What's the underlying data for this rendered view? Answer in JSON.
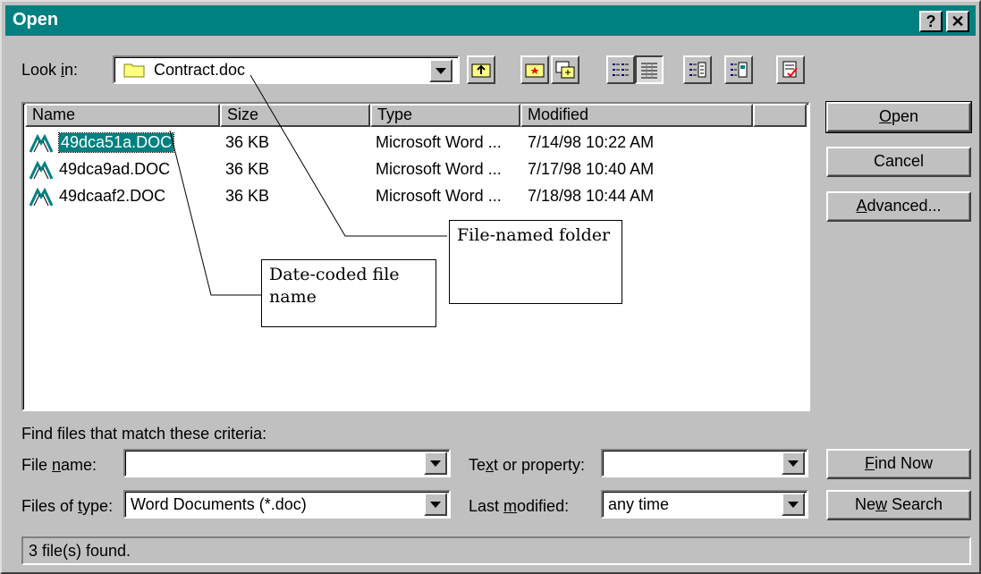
{
  "window": {
    "title": "Open",
    "help_glyph": "?",
    "close_glyph": "✕"
  },
  "look_in": {
    "label_pre": "Look ",
    "label_key": "i",
    "label_post": "n:",
    "value": "Contract.doc",
    "icon": "folder-icon"
  },
  "toolbar": {
    "icons": [
      "up-one-level-icon",
      "look-in-favorites-icon",
      "add-to-favorites-icon",
      "list-view-icon",
      "details-view-icon",
      "properties-view-icon",
      "preview-view-icon",
      "commands-and-settings-icon"
    ]
  },
  "file_list": {
    "columns": [
      "Name",
      "Size",
      "Type",
      "Modified"
    ],
    "rows": [
      {
        "name": "49dca51a.DOC",
        "size": "36 KB",
        "type": "Microsoft Word ...",
        "modified": "7/14/98 10:22 AM",
        "selected": true
      },
      {
        "name": "49dca9ad.DOC",
        "size": "36 KB",
        "type": "Microsoft Word ...",
        "modified": "7/17/98 10:40 AM",
        "selected": false
      },
      {
        "name": "49dcaaf2.DOC",
        "size": "36 KB",
        "type": "Microsoft Word ...",
        "modified": "7/18/98 10:44 AM",
        "selected": false
      }
    ],
    "file_icon": "word-document-icon"
  },
  "buttons": {
    "open_key": "O",
    "open_rest": "pen",
    "cancel": "Cancel",
    "advanced_key": "A",
    "advanced_rest": "dvanced...",
    "find_key": "F",
    "find_rest": "ind Now",
    "new_pre": "Ne",
    "new_key": "w",
    "new_rest": " Search"
  },
  "criteria": {
    "heading": "Find files that match these criteria:",
    "file_name_pre": "File ",
    "file_name_key": "n",
    "file_name_post": "ame:",
    "file_name_value": "",
    "files_of_type_pre": "Files of ",
    "files_of_type_key": "t",
    "files_of_type_post": "ype:",
    "files_of_type_value": "Word Documents (*.doc)",
    "text_prop_pre": "Te",
    "text_prop_key": "x",
    "text_prop_post": "t or property:",
    "text_prop_value": "",
    "last_mod_pre": "Last ",
    "last_mod_key": "m",
    "last_mod_post": "odified:",
    "last_mod_value": "any time"
  },
  "status": {
    "text": "3 file(s) found."
  },
  "callouts": {
    "folder": "File-named folder",
    "date": "Date-coded file name"
  },
  "colors": {
    "titlebar": "#008080",
    "selection": "#008080",
    "face": "#c0c0c0"
  }
}
